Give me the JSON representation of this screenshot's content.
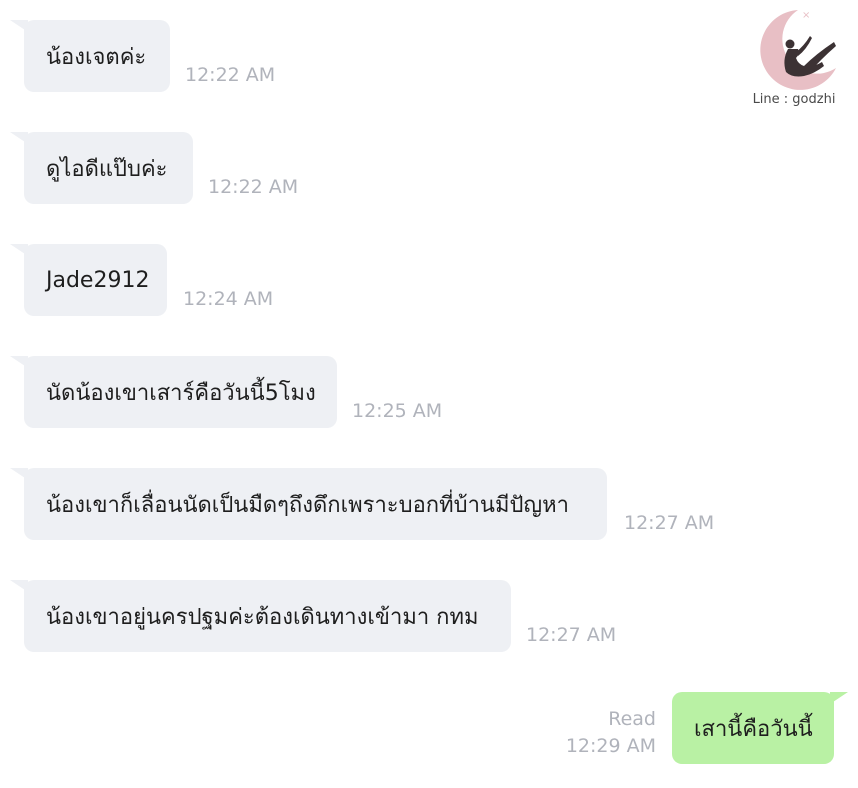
{
  "watermark": {
    "text": "Line : godzhi"
  },
  "messages": [
    {
      "text": "น้องเจตค่ะ",
      "time": "12:22 AM"
    },
    {
      "text": "ดูไอดีแป๊บค่ะ",
      "time": "12:22 AM"
    },
    {
      "text": "Jade2912",
      "time": "12:24 AM"
    },
    {
      "text": "นัดน้องเขาเสาร์คือวันนี้5โมง",
      "time": "12:25 AM"
    },
    {
      "text": "น้องเขาก็เลื่อนนัดเป็นมืดๆถึงดึกเพราะบอกที่บ้านมีปัญหา",
      "time": "12:27 AM"
    },
    {
      "text": "น้องเขาอยู่นครปฐมค่ะต้องเดินทางเข้ามา กทม",
      "time": "12:27 AM"
    }
  ],
  "outgoing": {
    "text": "เสานี้คือวันนี้",
    "status": "Read",
    "time": "12:29 AM"
  },
  "colors": {
    "incoming_bubble": "#eef0f4",
    "outgoing_bubble": "#b9f1a4",
    "timestamp": "#b0b3bb",
    "logo_moon": "#e8bfc5"
  }
}
